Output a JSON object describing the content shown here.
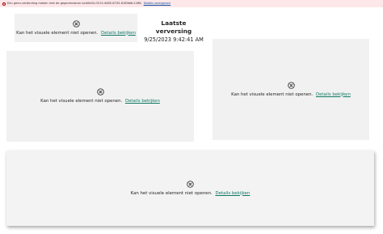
{
  "banner": {
    "message": "Een geen-verbinding maken met de gegevensbron bcb0b04-0513-4085-8705-6169b8c1266.",
    "link": "Details weergeven",
    "color": "#fde7e9"
  },
  "visual_error": {
    "message": "Kan het visuele element niet openen.",
    "details_link": "Details bekijken",
    "icon": "circle-x-icon"
  },
  "last_refresh": {
    "title": "Laatste verversing",
    "value": "9/25/2023 9:42:41 AM"
  },
  "colors": {
    "tile_bg": "#f1f1f1",
    "link": "#117865"
  }
}
